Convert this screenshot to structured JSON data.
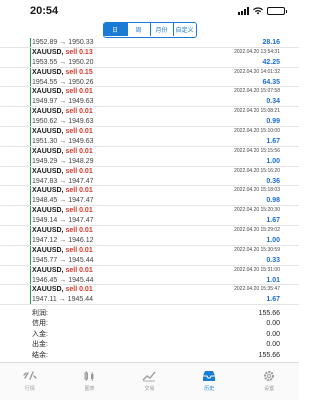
{
  "status": {
    "time": "20:54"
  },
  "segments": [
    {
      "label": "日",
      "active": true
    },
    {
      "label": "周",
      "active": false
    },
    {
      "label": "月份",
      "active": false
    },
    {
      "label": "自定义",
      "active": false
    }
  ],
  "partial_row": {
    "prices": "1952.89 → 1950.33",
    "profit": "28.16"
  },
  "trades": [
    {
      "symbol": "XAUUSD,",
      "action": "sell 0.13",
      "timestamp": "2022.04.20 13:54:31",
      "prices": "1953.55 → 1950.20",
      "profit": "42.25"
    },
    {
      "symbol": "XAUUSD,",
      "action": "sell 0.15",
      "timestamp": "2022.04.20 14:01:32",
      "prices": "1954.55 → 1950.26",
      "profit": "64.35"
    },
    {
      "symbol": "XAUUSD,",
      "action": "sell 0.01",
      "timestamp": "2022.04.20 15:07:58",
      "prices": "1949.97 → 1949.63",
      "profit": "0.34"
    },
    {
      "symbol": "XAUUSD,",
      "action": "sell 0.01",
      "timestamp": "2022.04.20 15:08:21",
      "prices": "1950.62 → 1949.63",
      "profit": "0.99"
    },
    {
      "symbol": "XAUUSD,",
      "action": "sell 0.01",
      "timestamp": "2022.04.20 15:10:00",
      "prices": "1951.30 → 1949.63",
      "profit": "1.67"
    },
    {
      "symbol": "XAUUSD,",
      "action": "sell 0.01",
      "timestamp": "2022.04.20 15:15:56",
      "prices": "1949.29 → 1948.29",
      "profit": "1.00"
    },
    {
      "symbol": "XAUUSD,",
      "action": "sell 0.01",
      "timestamp": "2022.04.20 15:16:20",
      "prices": "1947.83 → 1947.47",
      "profit": "0.36"
    },
    {
      "symbol": "XAUUSD,",
      "action": "sell 0.01",
      "timestamp": "2022.04.20 15:18:03",
      "prices": "1948.45 → 1947.47",
      "profit": "0.98"
    },
    {
      "symbol": "XAUUSD,",
      "action": "sell 0.01",
      "timestamp": "2022.04.20 15:20:30",
      "prices": "1949.14 → 1947.47",
      "profit": "1.67"
    },
    {
      "symbol": "XAUUSD,",
      "action": "sell 0.01",
      "timestamp": "2022.04.20 15:29:02",
      "prices": "1947.12 → 1946.12",
      "profit": "1.00"
    },
    {
      "symbol": "XAUUSD,",
      "action": "sell 0.01",
      "timestamp": "2022.04.20 15:30:59",
      "prices": "1945.77 → 1945.44",
      "profit": "0.33"
    },
    {
      "symbol": "XAUUSD,",
      "action": "sell 0.01",
      "timestamp": "2022.04.20 15:31:00",
      "prices": "1946.45 → 1945.44",
      "profit": "1.01"
    },
    {
      "symbol": "XAUUSD,",
      "action": "sell 0.01",
      "timestamp": "2022.04.20 15:35:47",
      "prices": "1947.11 → 1945.44",
      "profit": "1.67"
    }
  ],
  "summary": [
    {
      "label": "利润:",
      "value": "155.66"
    },
    {
      "label": "信用:",
      "value": "0.00"
    },
    {
      "label": "入金:",
      "value": "0.00"
    },
    {
      "label": "出金:",
      "value": "0.00"
    },
    {
      "label": "结余:",
      "value": "155.66"
    }
  ],
  "tabs": [
    {
      "label": "行情",
      "icon": "quotes-icon",
      "active": false
    },
    {
      "label": "图表",
      "icon": "chart-icon",
      "active": false
    },
    {
      "label": "交易",
      "icon": "trade-icon",
      "active": false
    },
    {
      "label": "历史",
      "icon": "history-icon",
      "active": true
    },
    {
      "label": "设置",
      "icon": "settings-icon",
      "active": false
    }
  ],
  "colors": {
    "accent": "#1a7bd6",
    "sell": "#d23a2c",
    "profit": "#1a6ed8",
    "marker": "#2c9a4a"
  }
}
